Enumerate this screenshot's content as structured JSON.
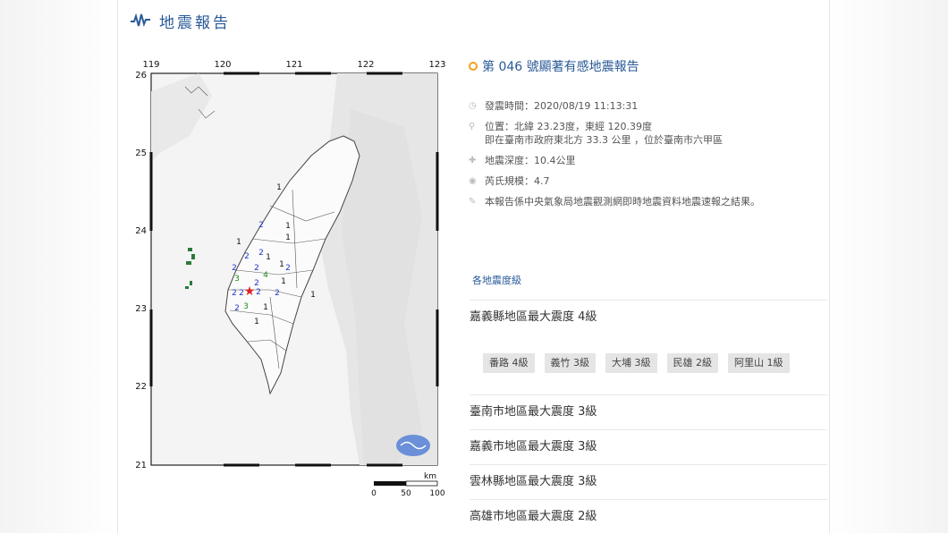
{
  "header": {
    "title": "地震報告"
  },
  "map": {
    "lon_ticks": [
      "119",
      "120",
      "121",
      "122",
      "123"
    ],
    "lat_ticks": [
      "26",
      "25",
      "24",
      "23",
      "22",
      "21"
    ],
    "scale": {
      "unit": "km",
      "labels": [
        "0",
        "50",
        "100"
      ]
    },
    "intensity_marks": [
      {
        "v": "1",
        "c": "#111"
      },
      {
        "v": "1",
        "c": "#111"
      },
      {
        "v": "2",
        "c": "#2233cc"
      },
      {
        "v": "1",
        "c": "#111"
      },
      {
        "v": "1",
        "c": "#111"
      },
      {
        "v": "2",
        "c": "#2233cc"
      },
      {
        "v": "2",
        "c": "#2233cc"
      },
      {
        "v": "1",
        "c": "#111"
      },
      {
        "v": "1",
        "c": "#111"
      },
      {
        "v": "2",
        "c": "#2233cc"
      },
      {
        "v": "2",
        "c": "#2233cc"
      },
      {
        "v": "4",
        "c": "#1a8a1a"
      },
      {
        "v": "3",
        "c": "#1a8a1a"
      },
      {
        "v": "1",
        "c": "#111"
      },
      {
        "v": "2",
        "c": "#2233cc"
      },
      {
        "v": "2",
        "c": "#2233cc"
      },
      {
        "v": "2",
        "c": "#2233cc"
      },
      {
        "v": "2",
        "c": "#2233cc"
      },
      {
        "v": "2",
        "c": "#2233cc"
      },
      {
        "v": "2",
        "c": "#2233cc"
      },
      {
        "v": "3",
        "c": "#1a8a1a"
      },
      {
        "v": "2",
        "c": "#2233cc"
      },
      {
        "v": "1",
        "c": "#111"
      },
      {
        "v": "1",
        "c": "#111"
      },
      {
        "v": "1",
        "c": "#111"
      }
    ],
    "epicenter_color": "#e02020"
  },
  "report": {
    "title": "第 046 號顯著有感地震報告",
    "time": "發震時間：2020/08/19 11:13:31",
    "location": "位置：北緯 23.23度，東經 120.39度",
    "location_detail": "即在臺南市政府東北方 33.3 公里 ，位於臺南市六甲區",
    "depth": "地震深度：10.4公里",
    "magnitude": "芮氏規模：4.7",
    "note": "本報告係中央氣象局地震觀測網即時地震資料地震速報之結果。"
  },
  "tab_label": "各地震度級",
  "regions": [
    {
      "label": "嘉義縣地區最大震度 4級",
      "stations": [
        "番路 4級",
        "義竹 3級",
        "大埔 3級",
        "民雄 2級",
        "阿里山 1級"
      ]
    },
    {
      "label": "臺南市地區最大震度 3級"
    },
    {
      "label": "嘉義市地區最大震度 3級"
    },
    {
      "label": "雲林縣地區最大震度 3級"
    },
    {
      "label": "高雄市地區最大震度 2級"
    }
  ]
}
